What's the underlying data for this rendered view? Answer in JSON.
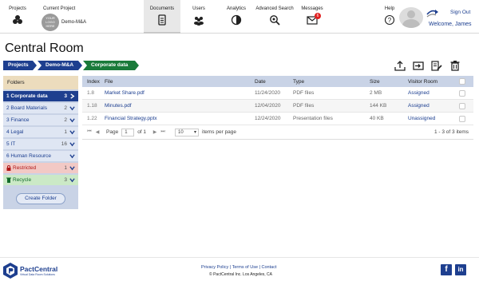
{
  "header": {
    "projects_label": "Projects",
    "current_project_label": "Current Project",
    "current_project_logo": "YOUR LOGO HERE",
    "current_project_name": "Demo-M&A",
    "nav": [
      {
        "label": "Documents",
        "icon": "document-icon"
      },
      {
        "label": "Users",
        "icon": "users-icon"
      },
      {
        "label": "Analytics",
        "icon": "pie-chart-icon"
      },
      {
        "label": "Advanced Search",
        "icon": "advanced-search-icon"
      },
      {
        "label": "Messages",
        "icon": "envelope-icon",
        "badge": "6"
      }
    ],
    "help_label": "Help",
    "sign_out": "Sign Out",
    "welcome": "Welcome, James"
  },
  "page": {
    "title": "Central Room",
    "breadcrumbs": [
      "Projects",
      "Demo-M&A",
      "Corporate data"
    ]
  },
  "folders": {
    "header": "Folders",
    "items": [
      {
        "label": "1 Corporate data",
        "count": "3"
      },
      {
        "label": "2 Board Materials",
        "count": "2"
      },
      {
        "label": "3 Finance",
        "count": "2"
      },
      {
        "label": "4 Legal",
        "count": "1"
      },
      {
        "label": "5 IT",
        "count": "16"
      },
      {
        "label": "6 Human Resource",
        "count": ""
      },
      {
        "label": "Restricted",
        "count": "1"
      },
      {
        "label": "Recycle",
        "count": "3"
      }
    ],
    "create_button": "Create Folder"
  },
  "table": {
    "columns": [
      "Index",
      "File",
      "Date",
      "Type",
      "Size",
      "Visitor Room"
    ],
    "rows": [
      {
        "index": "1.8",
        "file": "Market Share.pdf",
        "date": "11/24/2020",
        "type": "PDF files",
        "size": "2 MB",
        "room": "Assigned"
      },
      {
        "index": "1.18",
        "file": "Minutes.pdf",
        "date": "12/04/2020",
        "type": "PDF files",
        "size": "144 KB",
        "room": "Assigned"
      },
      {
        "index": "1.22",
        "file": "Financial Strategy.pptx",
        "date": "12/24/2020",
        "type": "Presentation files",
        "size": "40 KB",
        "room": "Unassigned"
      }
    ]
  },
  "pager": {
    "page_label": "Page",
    "page_value": "1",
    "of_label": "of 1",
    "per_page_value": "10",
    "per_page_label": "items per page",
    "summary": "1 - 3 of 3 items"
  },
  "footer": {
    "brand": "PactCentral",
    "tagline": "Virtual Data Room Solutions",
    "links": [
      "Privacy Policy",
      "Terms of Use",
      "Contact"
    ],
    "copyright": "© PactCentral Inc. Los Angeles, CA"
  },
  "colors": {
    "brand_navy": "#1e3f8f",
    "crumb_active": "#1a7a3a",
    "restricted_red": "#b01818",
    "recycle_green": "#136b2a",
    "badge_red": "#e02020"
  }
}
